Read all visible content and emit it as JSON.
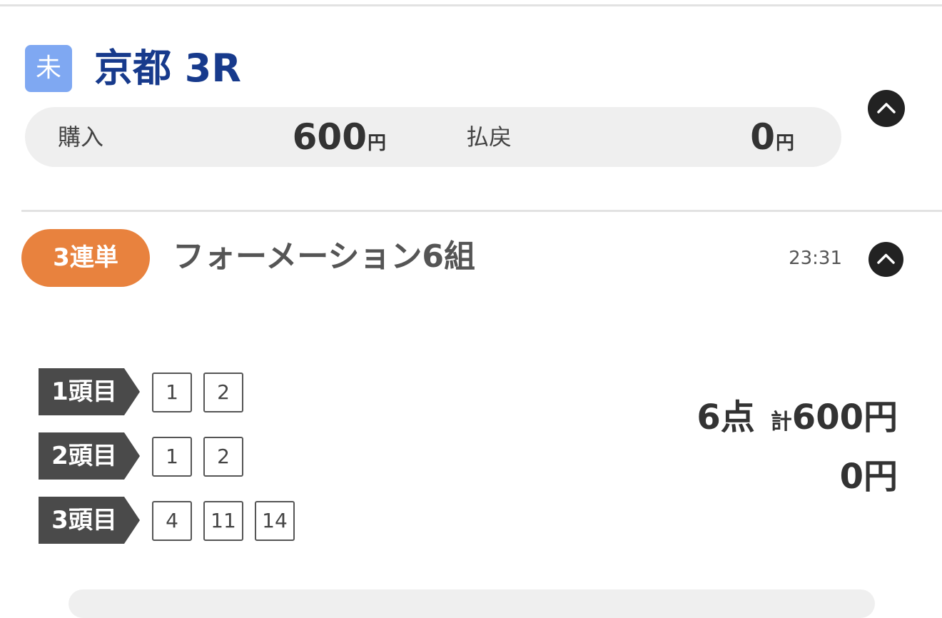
{
  "race": {
    "status_badge": "未",
    "title": "京都 3R",
    "purchase_label": "購入",
    "purchase_amount": "600",
    "purchase_unit": "円",
    "payout_label": "払戻",
    "payout_amount": "0",
    "payout_unit": "円"
  },
  "ticket": {
    "bet_type": "3連単",
    "description": "フォーメーション6組",
    "time": "23:31",
    "positions": [
      {
        "label": "1頭目",
        "numbers": [
          "1",
          "2"
        ]
      },
      {
        "label": "2頭目",
        "numbers": [
          "1",
          "2"
        ]
      },
      {
        "label": "3頭目",
        "numbers": [
          "4",
          "11",
          "14"
        ]
      }
    ],
    "points": "6点",
    "total_prefix": "計",
    "total": "600円",
    "payout": "0円"
  },
  "icons": {
    "collapse": "chevron-up-icon"
  },
  "colors": {
    "status_badge": "#7fa8f2",
    "race_title": "#173a8c",
    "bet_type_badge": "#e8823e",
    "position_label": "#4a4a4a",
    "summary_bg": "#efefef"
  }
}
